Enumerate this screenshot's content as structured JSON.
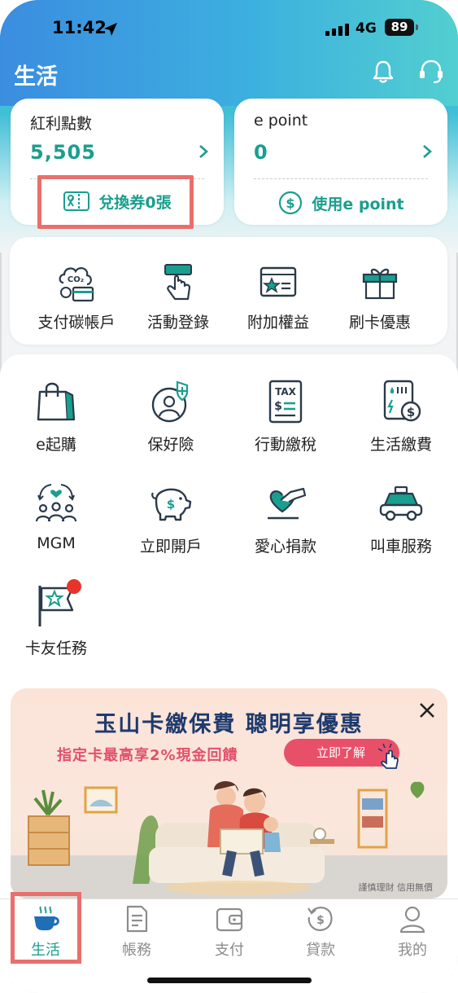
{
  "status_bar": {
    "time": "11:42",
    "network": "4G",
    "battery": "89"
  },
  "header": {
    "title": "生活"
  },
  "points": {
    "bonus": {
      "label": "紅利點數",
      "value": "5,505",
      "action": "兌換券0張"
    },
    "epoint": {
      "label": "e point",
      "value": "0",
      "action": "使用e point"
    }
  },
  "quick_actions": [
    {
      "label": "支付碳帳戶",
      "icon": "co2-card-icon"
    },
    {
      "label": "活動登錄",
      "icon": "tap-register-icon"
    },
    {
      "label": "附加權益",
      "icon": "star-card-icon"
    },
    {
      "label": "刷卡優惠",
      "icon": "gift-icon"
    }
  ],
  "services": [
    {
      "label": "e起購",
      "icon": "shopping-bag-icon"
    },
    {
      "label": "保好險",
      "icon": "insurance-icon"
    },
    {
      "label": "行動繳稅",
      "icon": "tax-icon"
    },
    {
      "label": "生活繳費",
      "icon": "bill-icon"
    },
    {
      "label": "MGM",
      "icon": "referral-icon"
    },
    {
      "label": "立即開戶",
      "icon": "piggy-bank-icon"
    },
    {
      "label": "愛心捐款",
      "icon": "donate-heart-icon"
    },
    {
      "label": "叫車服務",
      "icon": "taxi-icon"
    },
    {
      "label": "卡友任務",
      "icon": "mission-flag-icon"
    }
  ],
  "banner": {
    "headline": "玉山卡繳保費 聰明享優惠",
    "subline": "指定卡最高享2%現金回饋",
    "cta": "立即了解",
    "disclaimer": "謹慎理財 信用無價"
  },
  "tabs": [
    {
      "label": "生活",
      "active": true
    },
    {
      "label": "帳務",
      "active": false
    },
    {
      "label": "支付",
      "active": false
    },
    {
      "label": "貸款",
      "active": false
    },
    {
      "label": "我的",
      "active": false
    }
  ],
  "colors": {
    "accent": "#1a9e8f",
    "highlight": "#e96f6c",
    "notification": "#e8332b"
  }
}
